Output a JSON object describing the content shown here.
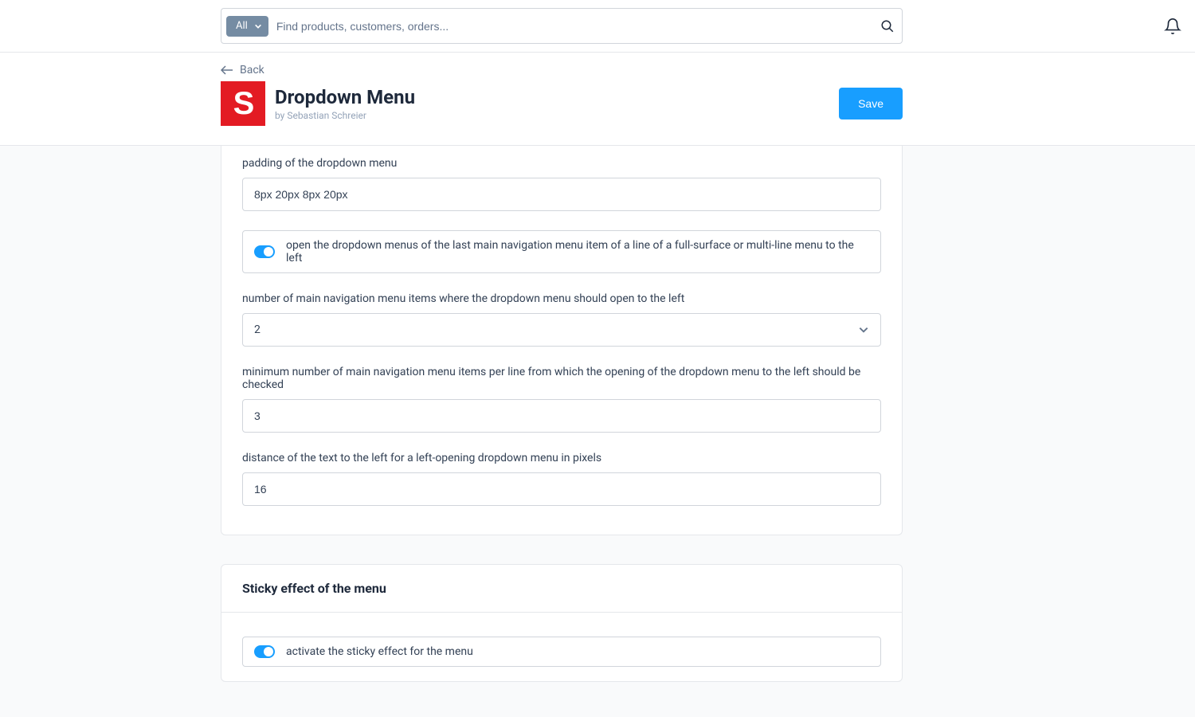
{
  "search": {
    "filter_label": "All",
    "placeholder": "Find products, customers, orders..."
  },
  "header": {
    "back_label": "Back",
    "title": "Dropdown Menu",
    "byline": "by Sebastian Schreier",
    "save_label": "Save",
    "logo_letter": "S"
  },
  "form": {
    "padding_label": "padding of the dropdown menu",
    "padding_value": "8px 20px 8px 20px",
    "open_left_toggle_label": "open the dropdown menus of the last main navigation menu item of a line of a full-surface or multi-line menu to the left",
    "open_left_toggle_on": true,
    "num_items_label": "number of main navigation menu items where the dropdown menu should open to the left",
    "num_items_value": "2",
    "min_items_label": "minimum number of main navigation menu items per line from which the opening of the dropdown menu to the left should be checked",
    "min_items_value": "3",
    "distance_label": "distance of the text to the left for a left-opening dropdown menu in pixels",
    "distance_value": "16"
  },
  "sticky": {
    "heading": "Sticky effect of the menu",
    "activate_label": "activate the sticky effect for the menu",
    "activate_on": true
  }
}
